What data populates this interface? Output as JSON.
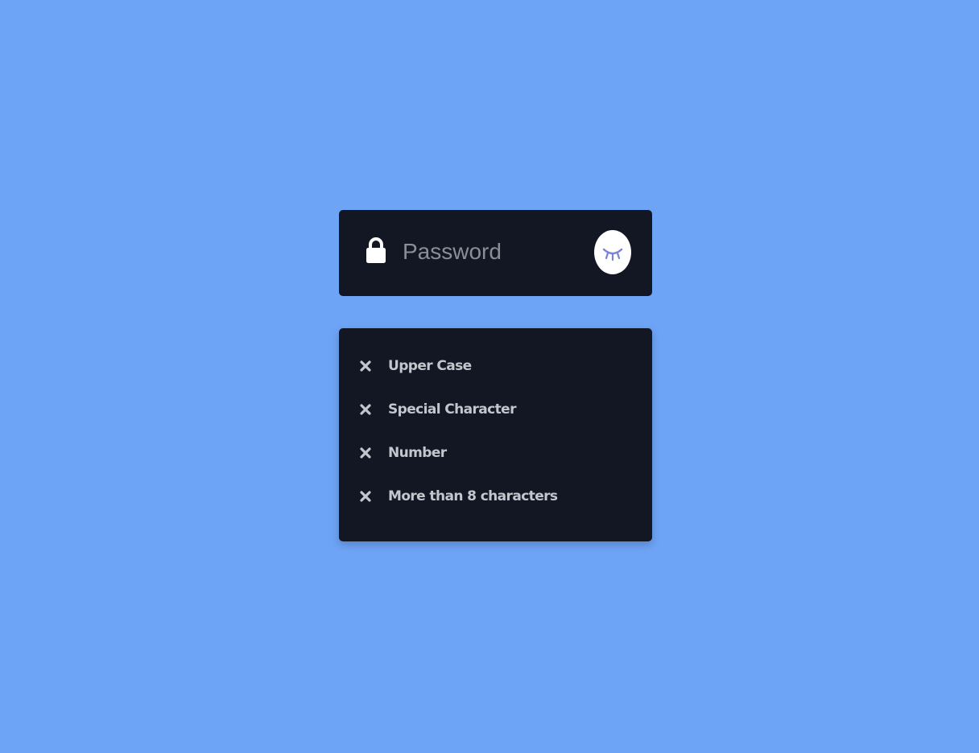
{
  "password_field": {
    "placeholder": "Password",
    "value": "",
    "lock_icon": "lock-icon",
    "toggle_icon": "eye-closed-icon"
  },
  "requirements": [
    {
      "label": "Upper Case",
      "status": "unmet",
      "icon": "x-icon"
    },
    {
      "label": "Special Character",
      "status": "unmet",
      "icon": "x-icon"
    },
    {
      "label": "Number",
      "status": "unmet",
      "icon": "x-icon"
    },
    {
      "label": "More than 8 characters",
      "status": "unmet",
      "icon": "x-icon"
    }
  ],
  "colors": {
    "background": "#6ea4f6",
    "panel": "#131724",
    "text": "#c3c6cd",
    "placeholder": "#8a8e97",
    "eye_accent": "#7b82d8"
  }
}
